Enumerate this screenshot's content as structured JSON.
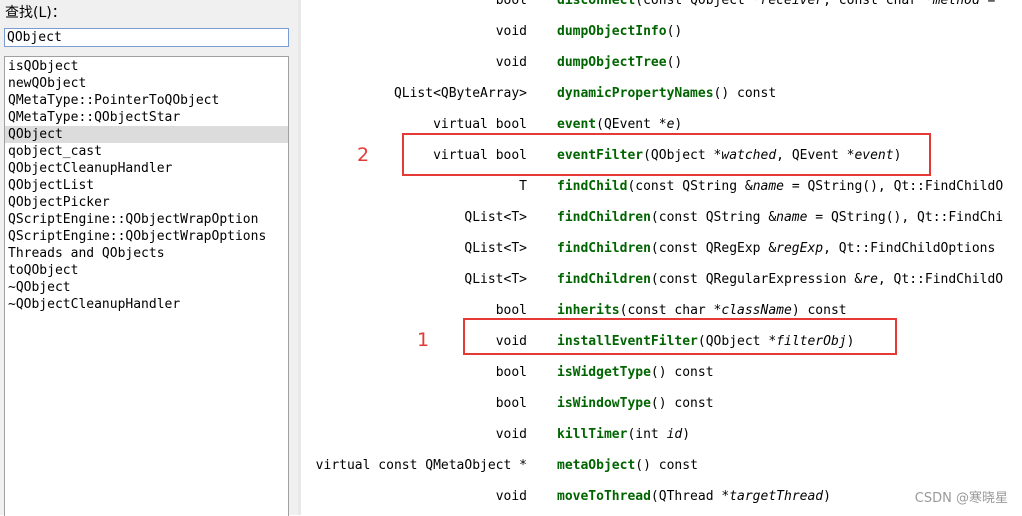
{
  "search": {
    "label": "查找(L)：",
    "value": "QObject"
  },
  "index_list": [
    "isQObject",
    "newQObject",
    "QMetaType::PointerToQObject",
    "QMetaType::QObjectStar",
    "QObject",
    "qobject_cast",
    "QObjectCleanupHandler",
    "QObjectList",
    "QObjectPicker",
    "QScriptEngine::QObjectWrapOption",
    "QScriptEngine::QObjectWrapOptions",
    "Threads and QObjects",
    "toQObject",
    "~QObject",
    "~QObjectCleanupHandler"
  ],
  "selected_index": 4,
  "members": [
    {
      "ret": "bool",
      "name": "disconnect",
      "pre": "(const QObject *",
      "p1": "receiver",
      "mid": ", const char *",
      "p2": "method",
      "post": " = "
    },
    {
      "ret": "void",
      "name": "dumpObjectInfo",
      "pre": "()",
      "p1": "",
      "mid": "",
      "p2": "",
      "post": ""
    },
    {
      "ret": "void",
      "name": "dumpObjectTree",
      "pre": "()",
      "p1": "",
      "mid": "",
      "p2": "",
      "post": ""
    },
    {
      "ret": "QList<QByteArray>",
      "name": "dynamicPropertyNames",
      "pre": "() const",
      "p1": "",
      "mid": "",
      "p2": "",
      "post": ""
    },
    {
      "ret": "virtual bool",
      "name": "event",
      "pre": "(QEvent *",
      "p1": "e",
      "mid": ")",
      "p2": "",
      "post": ""
    },
    {
      "ret": "virtual bool",
      "name": "eventFilter",
      "pre": "(QObject *",
      "p1": "watched",
      "mid": ", QEvent *",
      "p2": "event",
      "post": ")"
    },
    {
      "ret": "T",
      "name": "findChild",
      "pre": "(const QString &",
      "p1": "name",
      "mid": " = QString(), Qt::FindChildO",
      "p2": "",
      "post": ""
    },
    {
      "ret": "QList<T>",
      "name": "findChildren",
      "pre": "(const QString &",
      "p1": "name",
      "mid": " = QString(), Qt::FindChi",
      "p2": "",
      "post": ""
    },
    {
      "ret": "QList<T>",
      "name": "findChildren",
      "pre": "(const QRegExp &",
      "p1": "regExp",
      "mid": ", Qt::FindChildOptions",
      "p2": "",
      "post": ""
    },
    {
      "ret": "QList<T>",
      "name": "findChildren",
      "pre": "(const QRegularExpression &",
      "p1": "re",
      "mid": ", Qt::FindChildO",
      "p2": "",
      "post": ""
    },
    {
      "ret": "bool",
      "name": "inherits",
      "pre": "(const char *",
      "p1": "className",
      "mid": ") const",
      "p2": "",
      "post": ""
    },
    {
      "ret": "void",
      "name": "installEventFilter",
      "pre": "(QObject *",
      "p1": "filterObj",
      "mid": ")",
      "p2": "",
      "post": ""
    },
    {
      "ret": "bool",
      "name": "isWidgetType",
      "pre": "() const",
      "p1": "",
      "mid": "",
      "p2": "",
      "post": ""
    },
    {
      "ret": "bool",
      "name": "isWindowType",
      "pre": "() const",
      "p1": "",
      "mid": "",
      "p2": "",
      "post": ""
    },
    {
      "ret": "void",
      "name": "killTimer",
      "pre": "(int ",
      "p1": "id",
      "mid": ")",
      "p2": "",
      "post": ""
    },
    {
      "ret": "virtual const QMetaObject *",
      "name": "metaObject",
      "pre": "() const",
      "p1": "",
      "mid": "",
      "p2": "",
      "post": ""
    },
    {
      "ret": "void",
      "name": "moveToThread",
      "pre": "(QThread *",
      "p1": "targetThread",
      "mid": ")",
      "p2": "",
      "post": ""
    }
  ],
  "annotations": {
    "label_1": "1",
    "label_2": "2"
  },
  "watermark": "CSDN @寒晓星",
  "colors": {
    "function_name": "#006400",
    "annotation": "#e53935"
  }
}
